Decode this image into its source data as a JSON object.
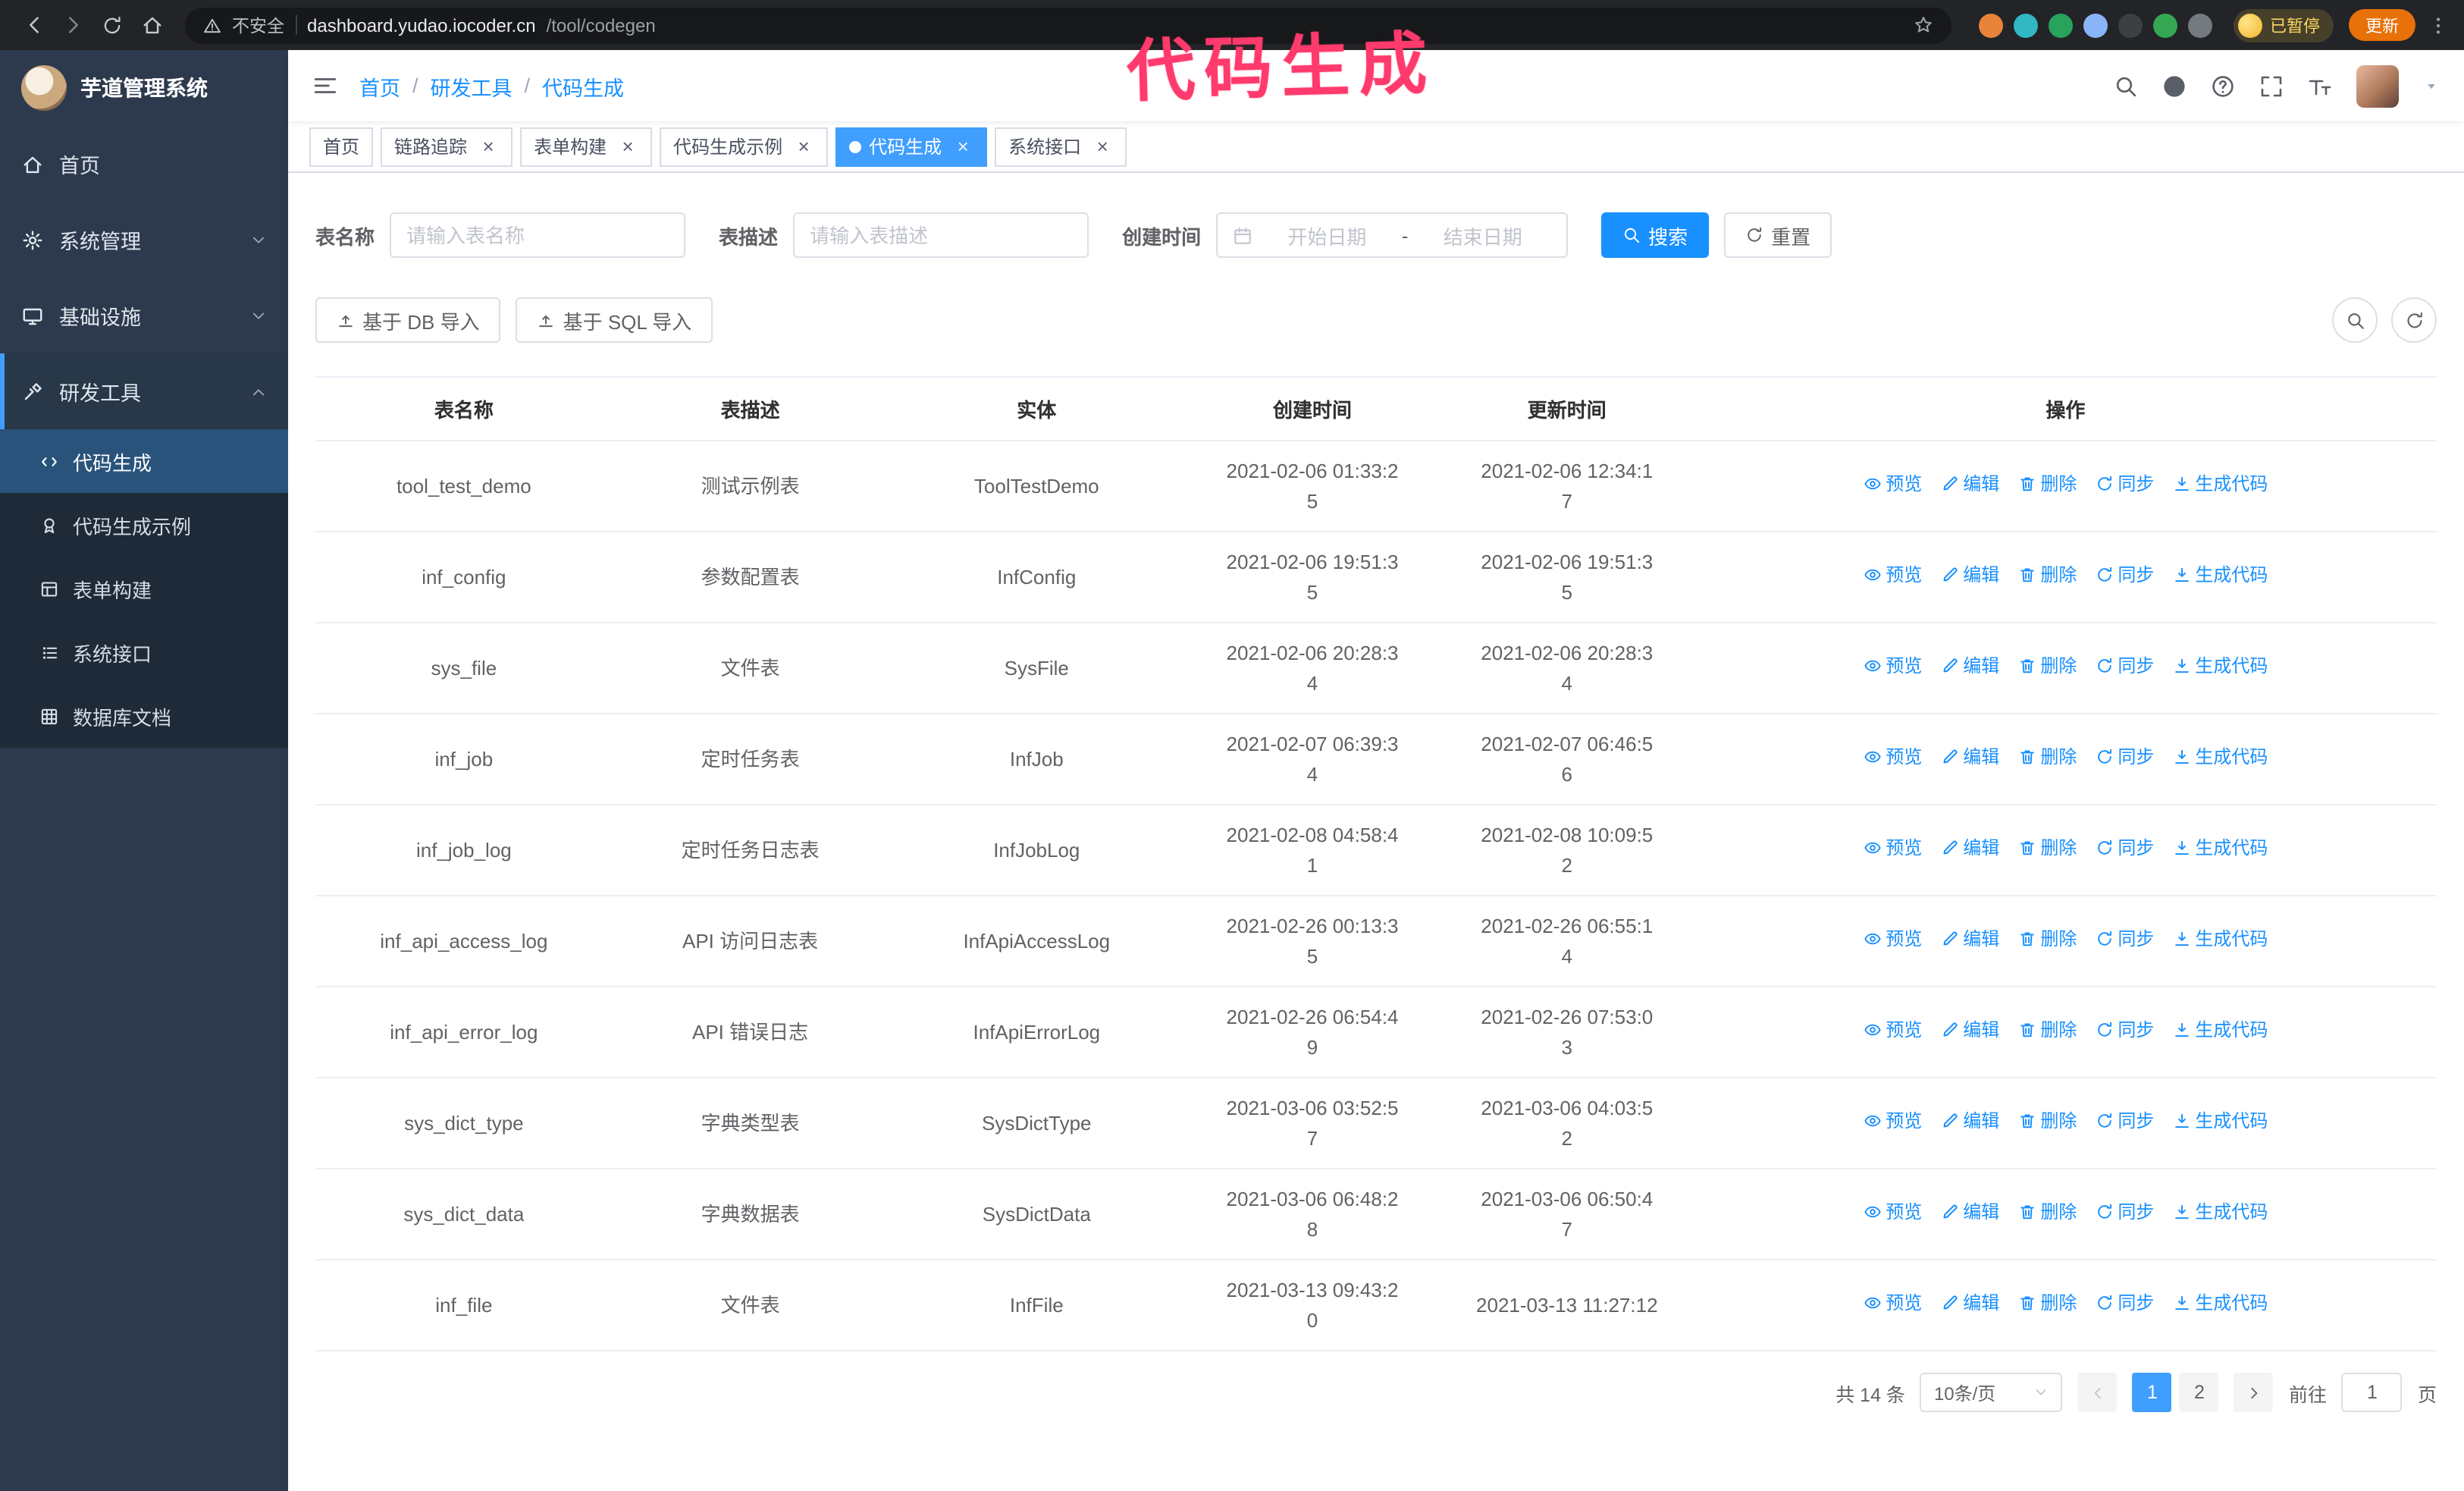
{
  "annotation": {
    "text": "代码生成",
    "color": "#ff3a6c"
  },
  "browser": {
    "security_text": "不安全",
    "url_host": "dashboard.yudao.iocoder.cn",
    "url_path": "/tool/codegen",
    "paused_chip_label": "已暂停",
    "update_button_label": "更新",
    "extensions": [
      {
        "name": "fox-extension-icon",
        "color": "#e8833a"
      },
      {
        "name": "drop-extension-icon",
        "color": "#31b8c2"
      },
      {
        "name": "check-extension-icon",
        "color": "#27a35c"
      },
      {
        "name": "people-extension-icon",
        "color": "#8ab4f8"
      },
      {
        "name": "dark-extension-icon",
        "color": "#3c4043"
      },
      {
        "name": "leaf-extension-icon",
        "color": "#34a853"
      },
      {
        "name": "puzzle-extension-icon",
        "color": "#757a80"
      }
    ]
  },
  "sidebar": {
    "title": "芋道管理系统",
    "menu": [
      {
        "id": "home",
        "label": "首页",
        "icon": "home"
      },
      {
        "id": "system",
        "label": "系统管理",
        "icon": "gear",
        "arrow": "down"
      },
      {
        "id": "infra",
        "label": "基础设施",
        "icon": "infra",
        "arrow": "down"
      },
      {
        "id": "devtools",
        "label": "研发工具",
        "icon": "tools",
        "arrow": "up",
        "active": true
      }
    ],
    "submenu": [
      {
        "id": "codegen",
        "label": "代码生成",
        "icon": "code",
        "active": true
      },
      {
        "id": "codegen-example",
        "label": "代码生成示例",
        "icon": "badge"
      },
      {
        "id": "form-build",
        "label": "表单构建",
        "icon": "form"
      },
      {
        "id": "api",
        "label": "系统接口",
        "icon": "sliders"
      },
      {
        "id": "db-doc",
        "label": "数据库文档",
        "icon": "grid"
      }
    ]
  },
  "header": {
    "breadcrumb": [
      "首页",
      "研发工具",
      "代码生成"
    ],
    "breadcrumb_separator": "/"
  },
  "tags": [
    {
      "id": "home",
      "label": "首页",
      "closable": false
    },
    {
      "id": "tracer",
      "label": "链路追踪",
      "closable": true
    },
    {
      "id": "form-build",
      "label": "表单构建",
      "closable": true
    },
    {
      "id": "codegen-example",
      "label": "代码生成示例",
      "closable": true
    },
    {
      "id": "codegen",
      "label": "代码生成",
      "closable": true,
      "active": true
    },
    {
      "id": "api",
      "label": "系统接口",
      "closable": true
    }
  ],
  "filters": {
    "table_name_label": "表名称",
    "table_name_placeholder": "请输入表名称",
    "table_desc_label": "表描述",
    "table_desc_placeholder": "请输入表描述",
    "create_time_label": "创建时间",
    "date_start_placeholder": "开始日期",
    "date_separator": "-",
    "date_end_placeholder": "结束日期",
    "search_label": "搜索",
    "reset_label": "重置"
  },
  "toolbar": {
    "import_db_label": "基于 DB 导入",
    "import_sql_label": "基于 SQL 导入"
  },
  "table": {
    "columns": [
      "表名称",
      "表描述",
      "实体",
      "创建时间",
      "更新时间",
      "操作"
    ],
    "actions": [
      {
        "id": "preview",
        "label": "预览",
        "icon": "eye"
      },
      {
        "id": "edit",
        "label": "编辑",
        "icon": "edit"
      },
      {
        "id": "delete",
        "label": "删除",
        "icon": "trash"
      },
      {
        "id": "sync",
        "label": "同步",
        "icon": "sync"
      },
      {
        "id": "generate",
        "label": "生成代码",
        "icon": "download"
      }
    ],
    "rows": [
      {
        "name": "tool_test_demo",
        "desc": "测试示例表",
        "entity": "ToolTestDemo",
        "created": "2021-02-06 01:33:25",
        "updated": "2021-02-06 12:34:17"
      },
      {
        "name": "inf_config",
        "desc": "参数配置表",
        "entity": "InfConfig",
        "created": "2021-02-06 19:51:35",
        "updated": "2021-02-06 19:51:35"
      },
      {
        "name": "sys_file",
        "desc": "文件表",
        "entity": "SysFile",
        "created": "2021-02-06 20:28:34",
        "updated": "2021-02-06 20:28:34"
      },
      {
        "name": "inf_job",
        "desc": "定时任务表",
        "entity": "InfJob",
        "created": "2021-02-07 06:39:34",
        "updated": "2021-02-07 06:46:56"
      },
      {
        "name": "inf_job_log",
        "desc": "定时任务日志表",
        "entity": "InfJobLog",
        "created": "2021-02-08 04:58:41",
        "updated": "2021-02-08 10:09:52"
      },
      {
        "name": "inf_api_access_log",
        "desc": "API 访问日志表",
        "entity": "InfApiAccessLog",
        "created": "2021-02-26 00:13:35",
        "updated": "2021-02-26 06:55:14"
      },
      {
        "name": "inf_api_error_log",
        "desc": "API 错误日志",
        "entity": "InfApiErrorLog",
        "created": "2021-02-26 06:54:49",
        "updated": "2021-02-26 07:53:03"
      },
      {
        "name": "sys_dict_type",
        "desc": "字典类型表",
        "entity": "SysDictType",
        "created": "2021-03-06 03:52:57",
        "updated": "2021-03-06 04:03:52"
      },
      {
        "name": "sys_dict_data",
        "desc": "字典数据表",
        "entity": "SysDictData",
        "created": "2021-03-06 06:48:28",
        "updated": "2021-03-06 06:50:47"
      },
      {
        "name": "inf_file",
        "desc": "文件表",
        "entity": "InfFile",
        "created": "2021-03-13 09:43:20",
        "updated": "2021-03-13 11:27:12"
      }
    ]
  },
  "pagination": {
    "total_text": "共 14 条",
    "page_size_text": "10条/页",
    "pages": [
      "1",
      "2"
    ],
    "active_page": "1",
    "goto_prefix": "前往",
    "goto_value": "1",
    "goto_suffix": "页"
  },
  "colors": {
    "primary": "#1890ff",
    "active_tab": "#409eff",
    "sidebar_bg": "#2d3a4d",
    "annotation": "#ff3a6c"
  }
}
